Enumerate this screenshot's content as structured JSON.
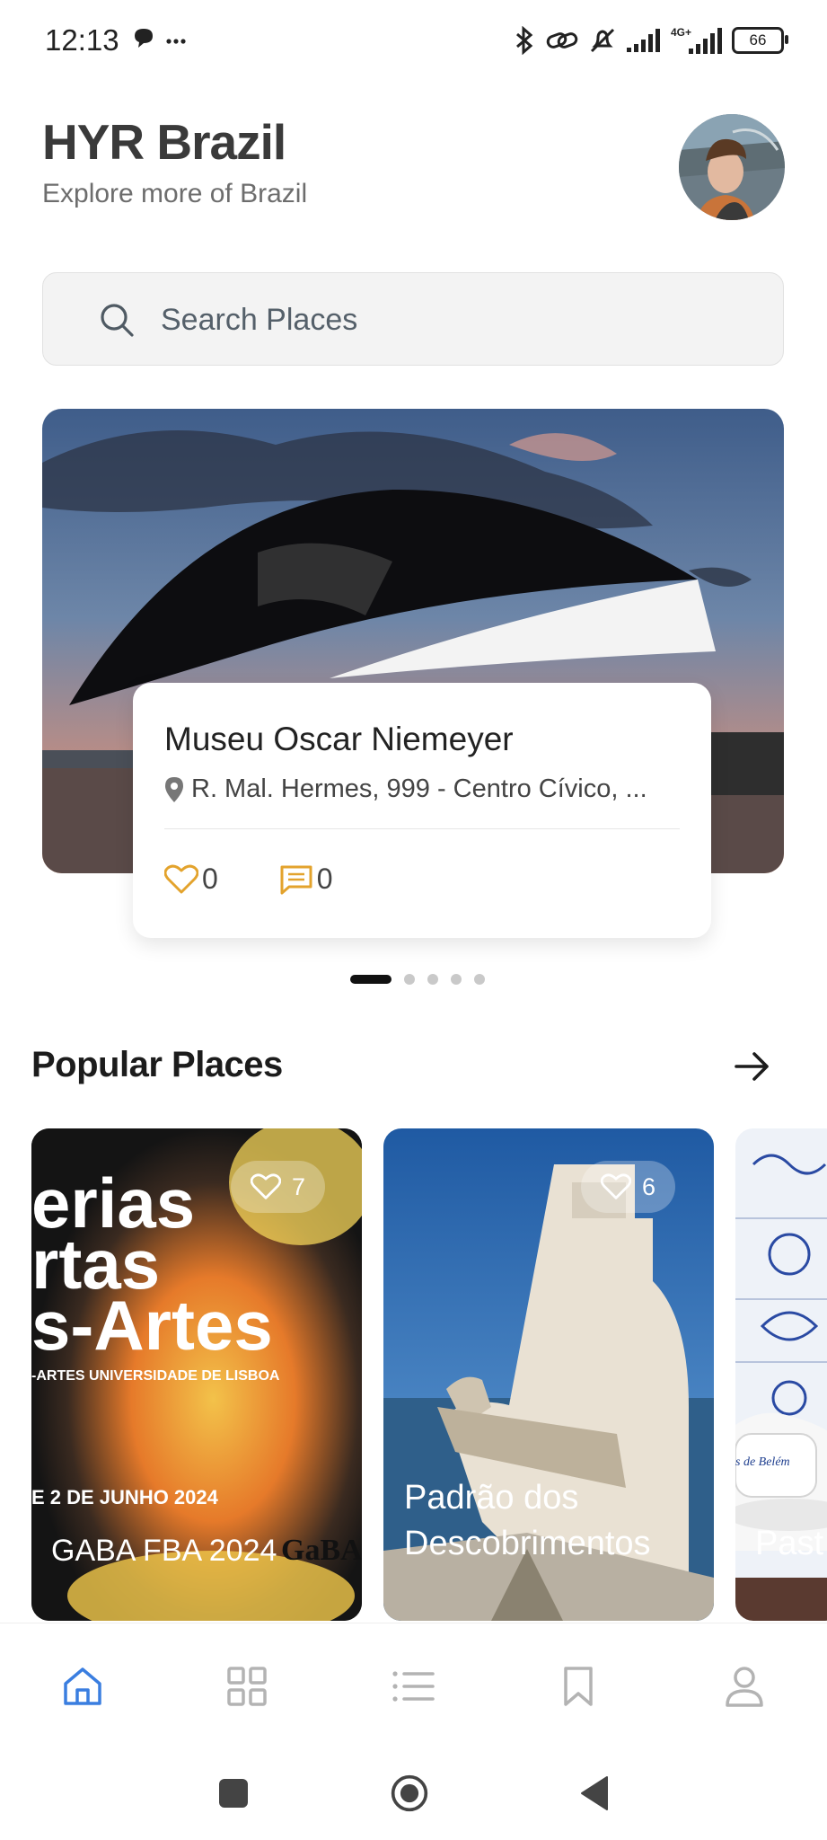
{
  "status_bar": {
    "time": "12:13",
    "network": "4G+",
    "battery": "66",
    "icons": [
      "chat-bubble-icon",
      "more-dots-icon",
      "bluetooth-icon",
      "link-icon",
      "bell-off-icon",
      "signal-icon",
      "signal-4g-icon",
      "battery-icon"
    ]
  },
  "header": {
    "title": "HYR Brazil",
    "subtitle": "Explore more of Brazil"
  },
  "search": {
    "placeholder": "Search Places"
  },
  "featured": {
    "title": "Museu Oscar Niemeyer",
    "address": "R. Mal. Hermes, 999 - Centro Cívico, ...",
    "likes": "0",
    "comments": "0",
    "pages": 5,
    "active_page": 0
  },
  "popular": {
    "title": "Popular Places",
    "items": [
      {
        "likes": "7",
        "poster_lines": [
          "erias",
          "rtas",
          "s-Artes"
        ],
        "poster_sub": "-ARTES UNIVERSIDADE DE LISBOA",
        "poster_date": "E 2 DE JUNHO 2024",
        "poster_footer": "GABA FBA 2024",
        "poster_logo": "GaBA"
      },
      {
        "likes": "6",
        "name": "Padrão dos Descobrimentos"
      },
      {
        "name": "Past",
        "cup_text": "s de Belém"
      }
    ]
  },
  "bottom_nav": {
    "items": [
      "home",
      "categories",
      "list",
      "saved",
      "profile"
    ],
    "active": "home",
    "active_color": "#3a7ee0",
    "inactive_color": "#b3b3b3"
  }
}
